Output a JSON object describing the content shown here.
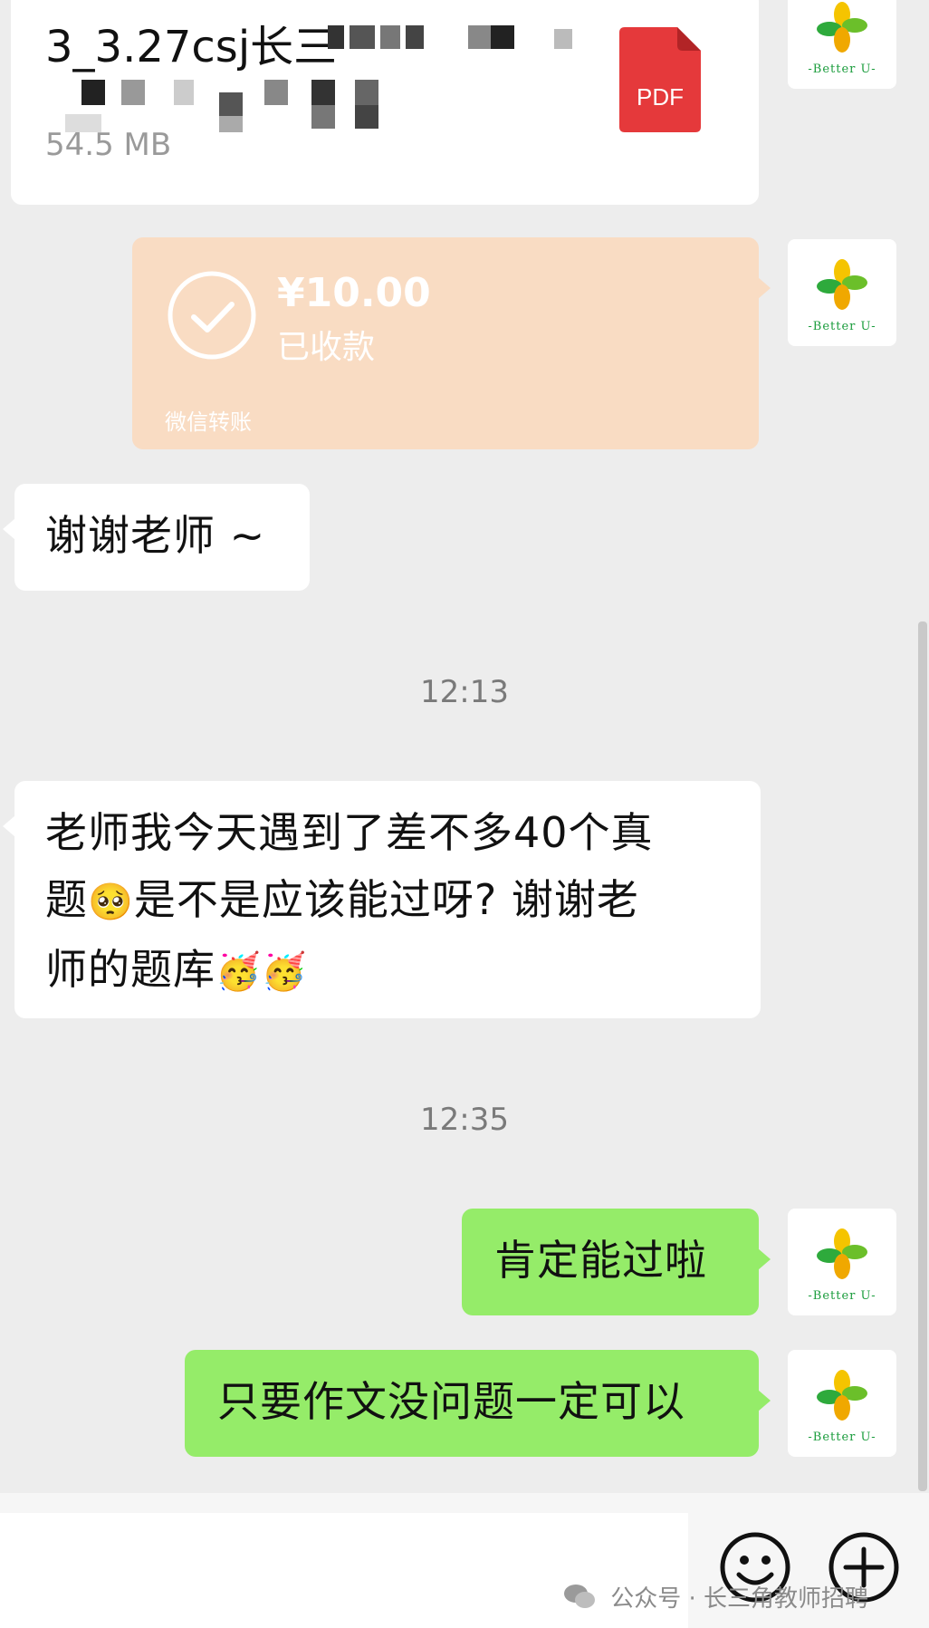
{
  "file_message": {
    "filename": "3_3.27csj长三",
    "size": "54.5 MB",
    "file_type_label": "PDF"
  },
  "transfer_message": {
    "amount": "¥10.00",
    "status": "已收款",
    "source": "微信转账"
  },
  "messages": {
    "thanks": "谢谢老师 ~",
    "time1": "12:13",
    "long_line1": "老师我今天遇到了差不多40个真",
    "long_line2a": "题",
    "long_line2b": "是不是应该能过呀? 谢谢老",
    "long_line3": "师的题库",
    "emoji_pleading": "🥺",
    "emoji_party1": "🥳",
    "emoji_party2": "🥳",
    "time2": "12:35",
    "reply1": "肯定能过啦",
    "reply2": "只要作文没问题一定可以"
  },
  "avatar": {
    "caption": "-Better U-"
  },
  "input_bar": {
    "emoji_icon": "smile-face-icon",
    "add_icon": "plus-circle-icon"
  },
  "watermark": {
    "text": "公众号 · 长三角教师招聘"
  },
  "colors": {
    "background": "#ededed",
    "bubble_green": "#95ec69",
    "transfer_peach": "#f9dcc3",
    "pdf_red": "#e5393b"
  }
}
